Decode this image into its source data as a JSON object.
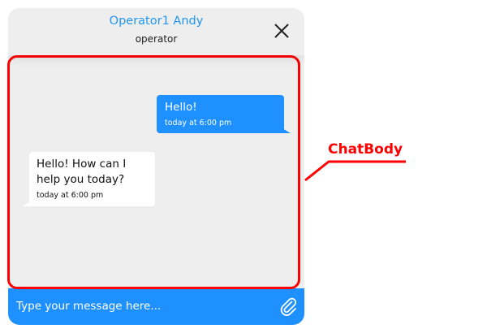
{
  "header": {
    "title": "Operator1 Andy",
    "subtitle": "operator",
    "close_icon": "close-icon"
  },
  "messages": [
    {
      "direction": "outgoing",
      "text": "Hello!",
      "time": "today at 6:00 pm"
    },
    {
      "direction": "incoming",
      "text": "Hello! How can I help you today?",
      "time": "today at 6:00 pm"
    }
  ],
  "composer": {
    "placeholder": "Type your message here...",
    "attach_icon": "paperclip-icon"
  },
  "annotation": {
    "label": "ChatBody"
  },
  "colors": {
    "accent": "#1e90ff",
    "header_title": "#2196f3",
    "panel_bg": "#eeeeee",
    "incoming_bubble": "#ffffff",
    "annotation": "#ff0000"
  }
}
